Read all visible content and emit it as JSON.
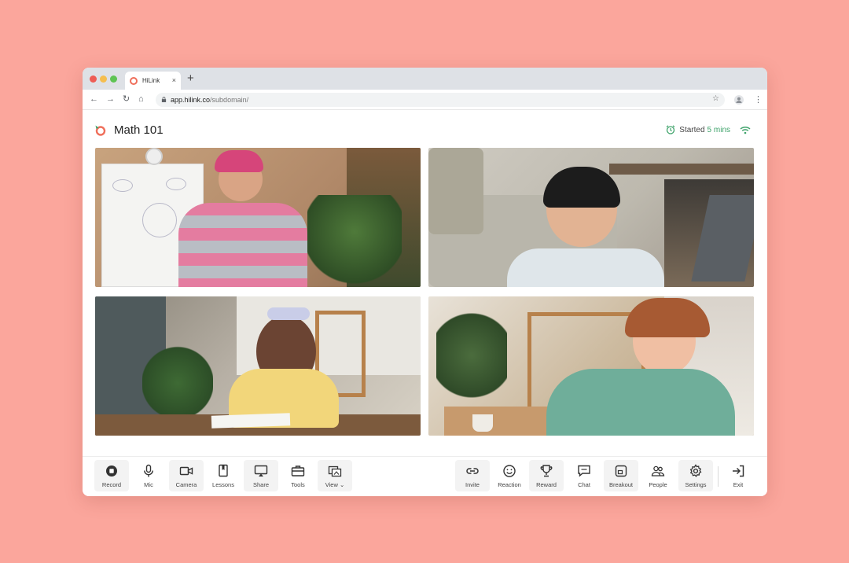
{
  "browser": {
    "tab_title": "HiLink",
    "tab_close": "×",
    "new_tab": "+",
    "url_host": "app.hilink.co",
    "url_path": "/subdomain/"
  },
  "app": {
    "title": "Math 101",
    "status_label": "Started",
    "status_time": "5 mins",
    "accent_color": "#3fa36b",
    "logo_color": "#ef6f5b"
  },
  "video_tiles": [
    {
      "participant": "teacher-at-whiteboard"
    },
    {
      "participant": "boy-on-sofa"
    },
    {
      "participant": "girl-writing"
    },
    {
      "participant": "girl-in-hoodie"
    }
  ],
  "toolbar": {
    "left": [
      {
        "label": "Record",
        "icon": "record-icon"
      },
      {
        "label": "Mic",
        "icon": "mic-icon"
      },
      {
        "label": "Camera",
        "icon": "camera-icon"
      },
      {
        "label": "Lessons",
        "icon": "lessons-icon"
      },
      {
        "label": "Share",
        "icon": "share-icon"
      },
      {
        "label": "Tools",
        "icon": "tools-icon"
      },
      {
        "label": "View",
        "icon": "view-icon"
      }
    ],
    "right": [
      {
        "label": "Invite",
        "icon": "link-icon"
      },
      {
        "label": "Reaction",
        "icon": "smiley-icon"
      },
      {
        "label": "Reward",
        "icon": "trophy-icon"
      },
      {
        "label": "Chat",
        "icon": "chat-icon"
      },
      {
        "label": "Breakout",
        "icon": "breakout-icon"
      },
      {
        "label": "People",
        "icon": "people-icon"
      },
      {
        "label": "Settings",
        "icon": "gear-icon"
      },
      {
        "label": "Exit",
        "icon": "exit-icon"
      }
    ]
  }
}
